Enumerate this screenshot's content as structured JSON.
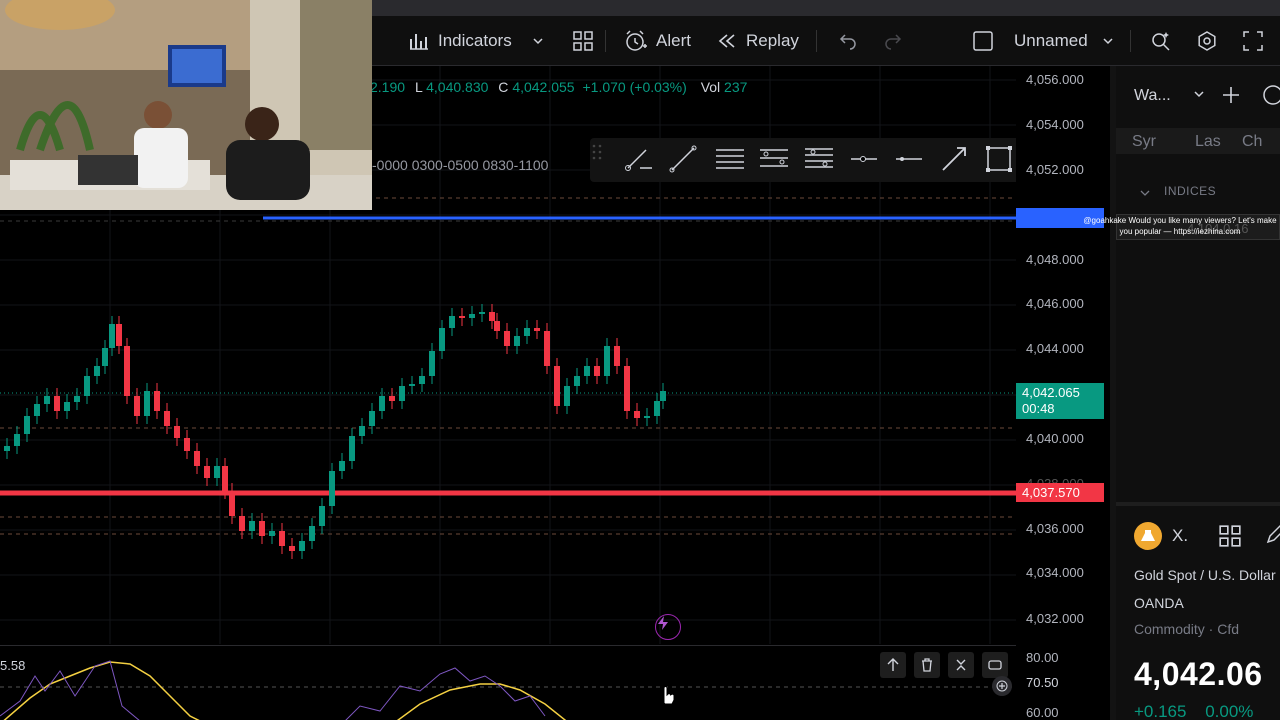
{
  "toolbar": {
    "indicators_label": "Indicators",
    "alert_label": "Alert",
    "replay_label": "Replay",
    "layout_name": "Unnamed"
  },
  "legend": {
    "high_tail": "2.190",
    "low_label": "L",
    "low_value": "4,040.830",
    "close_label": "C",
    "close_value": "4,042.055",
    "change": "+1.070 (+0.03%)",
    "vol_label": "Vol",
    "vol_value": "237"
  },
  "sessions_text": "-0000 0300-0500 0830-1100",
  "price_axis": {
    "labels": [
      "4,056.000",
      "4,054.000",
      "4,052.000",
      "4,048.000",
      "4,046.000",
      "4,044.000",
      "4,040.000",
      "4,036.000",
      "4,034.000",
      "4,032.000"
    ],
    "current_price": "4,042.065",
    "countdown": "00:48",
    "red_line_price": "4,037.570",
    "hidden_label": "4,038.000"
  },
  "indicator": {
    "value_left": "5.58",
    "axis_top": "80.00",
    "axis_mid": "70.50",
    "axis_bottom": "60.00"
  },
  "watchlist": {
    "title": "Wa...",
    "col_symbol": "Syr",
    "col_last": "Las",
    "col_change": "Ch",
    "section": "INDICES",
    "row_values": "4,104  0.16"
  },
  "symbol_details": {
    "short": "X.",
    "name": "Gold Spot / U.S. Dollar",
    "exchange": "OANDA",
    "type": "Commodity · Cfd",
    "price": "4,042.06",
    "change": "+0.165",
    "change_pct": "0.00%"
  },
  "notification": {
    "text": "@goahkake Would you like many viewers? Let's make you popular — https://iezhina.com"
  },
  "colors": {
    "up": "#089981",
    "down": "#f23645",
    "accent": "#2962ff"
  }
}
